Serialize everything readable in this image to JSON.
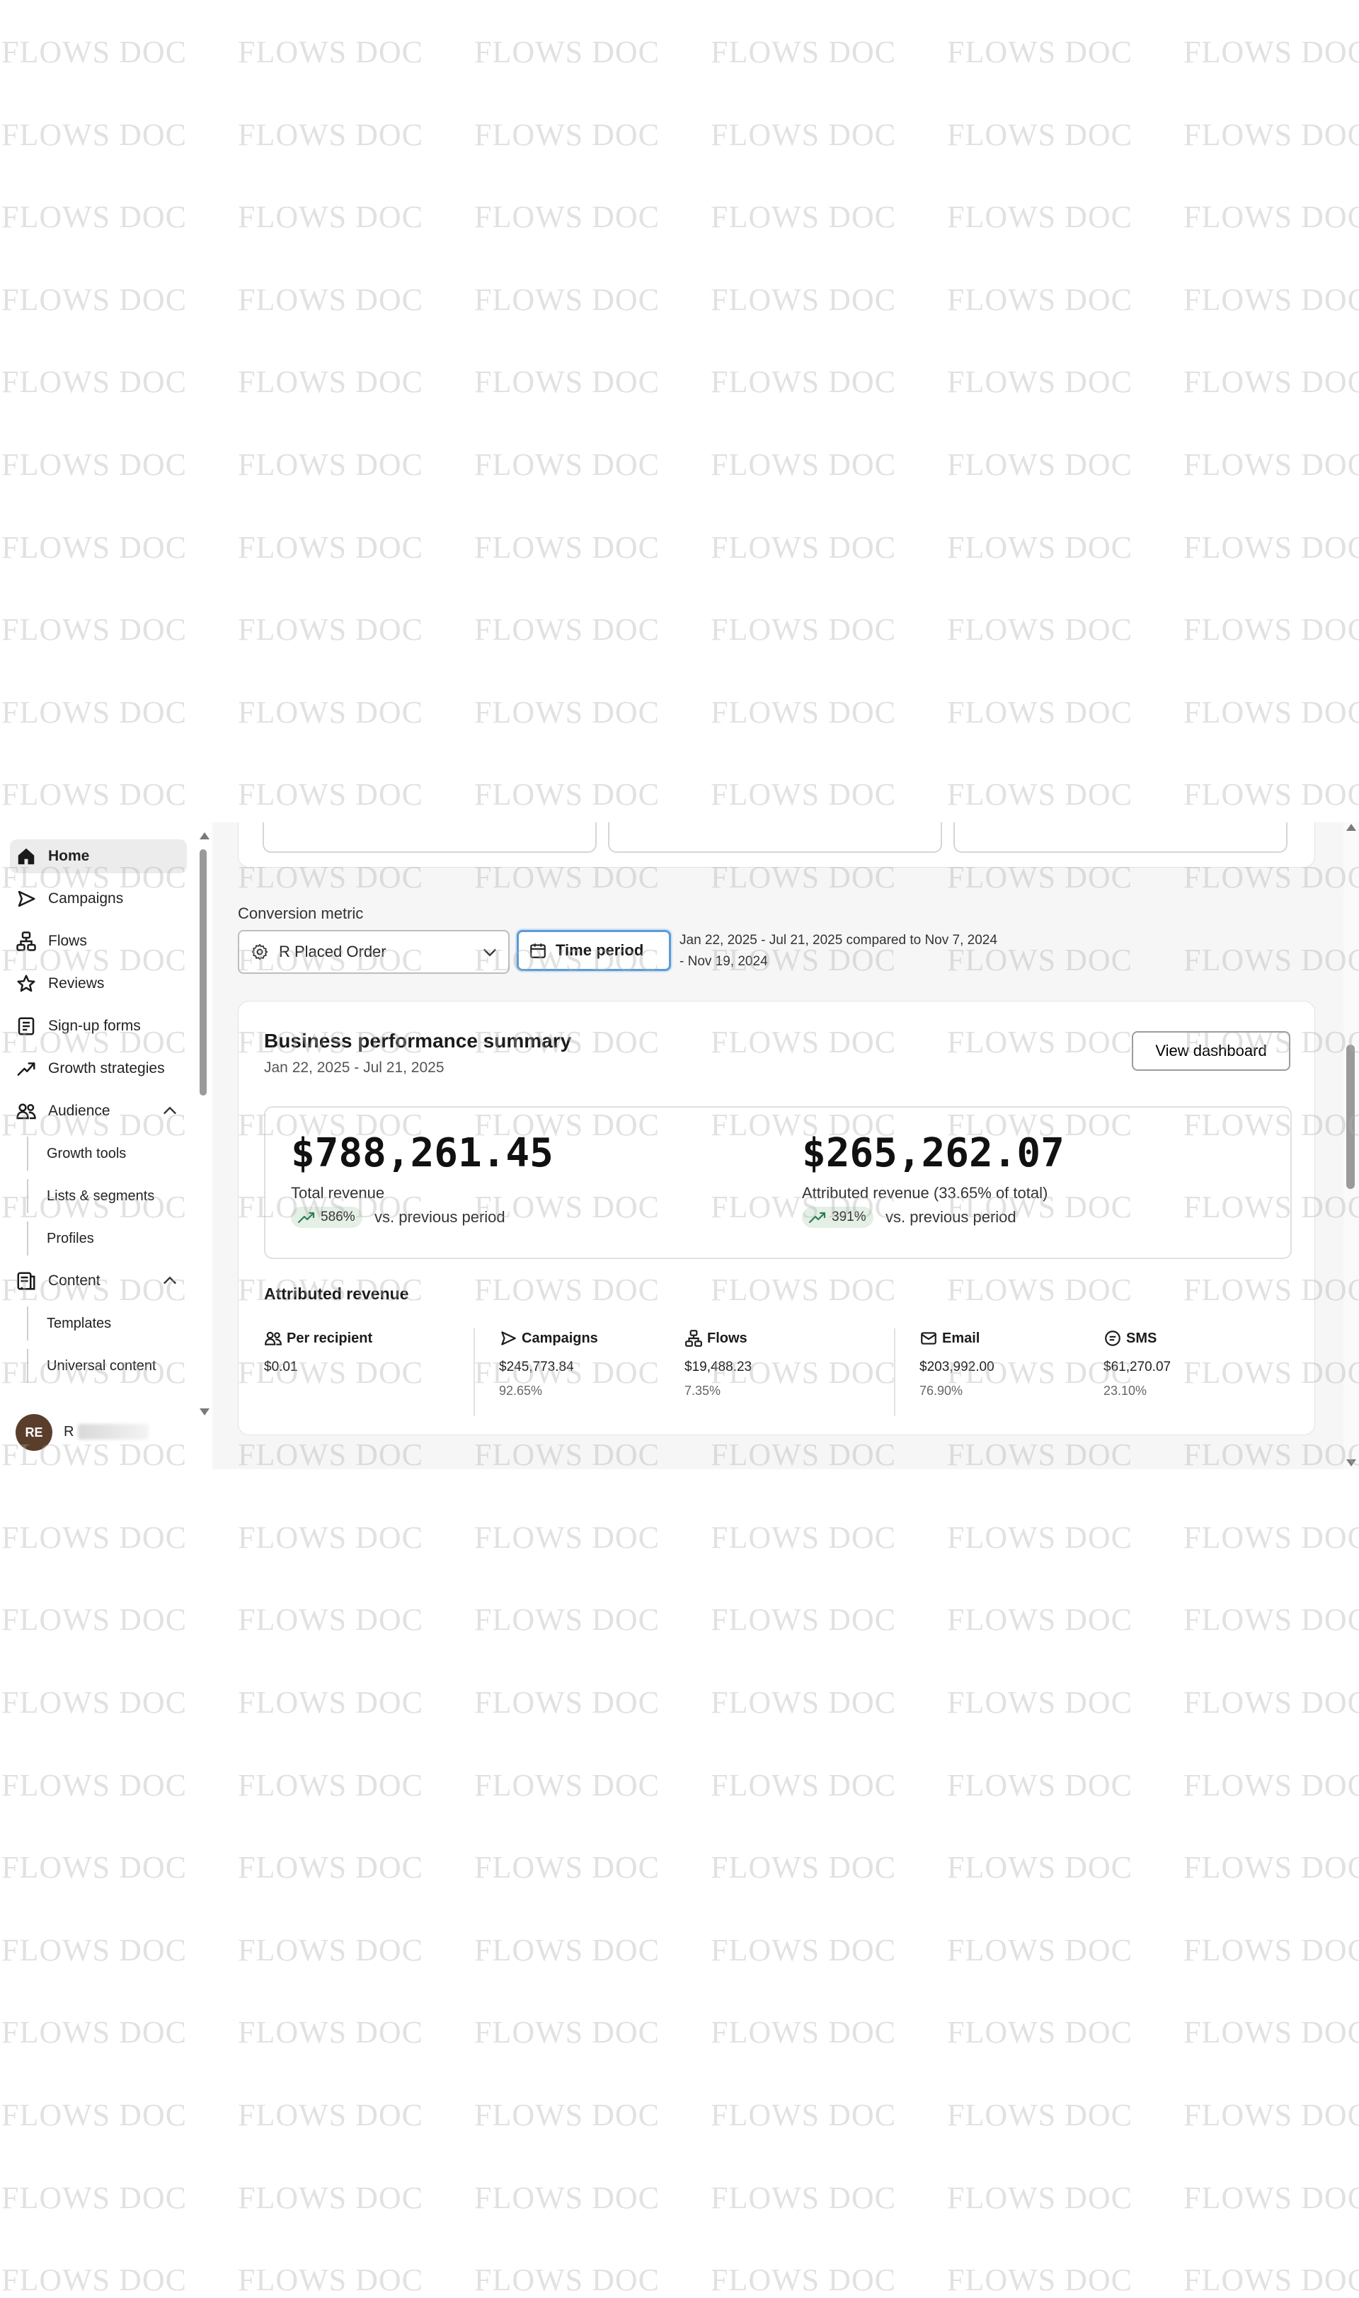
{
  "watermark": {
    "text": "FLOWS DOC"
  },
  "sidebar": {
    "items": [
      {
        "label": "Home",
        "icon": "home-icon",
        "active": true
      },
      {
        "label": "Campaigns",
        "icon": "send-icon"
      },
      {
        "label": "Flows",
        "icon": "flows-icon"
      },
      {
        "label": "Reviews",
        "icon": "star-icon"
      },
      {
        "label": "Sign-up forms",
        "icon": "form-icon"
      },
      {
        "label": "Growth strategies",
        "icon": "trend-icon"
      },
      {
        "label": "Audience",
        "icon": "people-icon",
        "expanded": true
      },
      {
        "label": "Growth tools",
        "sub": true
      },
      {
        "label": "Lists & segments",
        "sub": true
      },
      {
        "label": "Profiles",
        "sub": true
      },
      {
        "label": "Content",
        "icon": "content-icon",
        "expanded": true
      },
      {
        "label": "Templates",
        "sub": true
      },
      {
        "label": "Universal content",
        "sub": true
      }
    ],
    "user": {
      "initials": "RE",
      "name": "R"
    }
  },
  "filters": {
    "conversion_metric_label": "Conversion metric",
    "conversion_metric_value": "R Placed Order",
    "time_period_label": "Time period",
    "date_compare": "Jan 22, 2025 - Jul 21, 2025 compared to Nov 7, 2024 - Nov 19, 2024"
  },
  "summary": {
    "title": "Business performance summary",
    "date_range": "Jan 22, 2025 - Jul 21, 2025",
    "view_button": "View dashboard",
    "total_revenue": {
      "value": "$788,261.45",
      "label": "Total revenue",
      "change": "586%",
      "vs": "vs. previous period"
    },
    "attributed_revenue": {
      "value": "$265,262.07",
      "label": "Attributed revenue (33.65% of total)",
      "change": "391%",
      "vs": "vs. previous period"
    },
    "attributed_section_title": "Attributed revenue",
    "metrics": [
      {
        "label": "Per recipient",
        "icon": "people-icon",
        "value": "$0.01",
        "pct": ""
      },
      {
        "label": "Campaigns",
        "icon": "send-icon",
        "value": "$245,773.84",
        "pct": "92.65%"
      },
      {
        "label": "Flows",
        "icon": "flows-icon",
        "value": "$19,488.23",
        "pct": "7.35%"
      },
      {
        "label": "Email",
        "icon": "mail-icon",
        "value": "$203,992.00",
        "pct": "76.90%"
      },
      {
        "label": "SMS",
        "icon": "sms-icon",
        "value": "$61,270.07",
        "pct": "23.10%"
      }
    ]
  },
  "colors": {
    "accent": "#5b9bd5",
    "positive": "#2e7d4f",
    "active_bg": "#ececec",
    "avatar": "#5a3e2b"
  }
}
